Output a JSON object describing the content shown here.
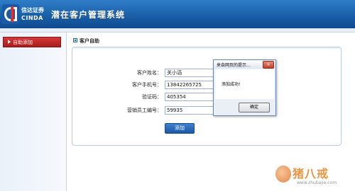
{
  "header": {
    "logo_cn": "信达证券",
    "logo_en": "CINDA",
    "title": "潜在客户管理系统"
  },
  "sidebar": {
    "items": [
      {
        "label": "自助添加",
        "active": true
      }
    ]
  },
  "main": {
    "section_title": "客户自助",
    "form": {
      "fields": [
        {
          "label": "客户姓名：",
          "value": "关小滔"
        },
        {
          "label": "客户手机号：",
          "value": "13842265725"
        },
        {
          "label": "验证码：",
          "value": "405354"
        },
        {
          "label": "营销员工编号：",
          "value": "59935"
        }
      ],
      "submit_label": "添加"
    }
  },
  "dialog": {
    "title": "来自网页的提示...",
    "close_label": "×",
    "message": "添加成功!",
    "ok_label": "确定"
  },
  "watermark": {
    "text": "猪八戒",
    "url": "www.zhubajie.com"
  },
  "colors": {
    "header_blue": "#1a5fa8",
    "sidebar_active_red": "#c02828",
    "button_blue": "#2a6cbd"
  }
}
